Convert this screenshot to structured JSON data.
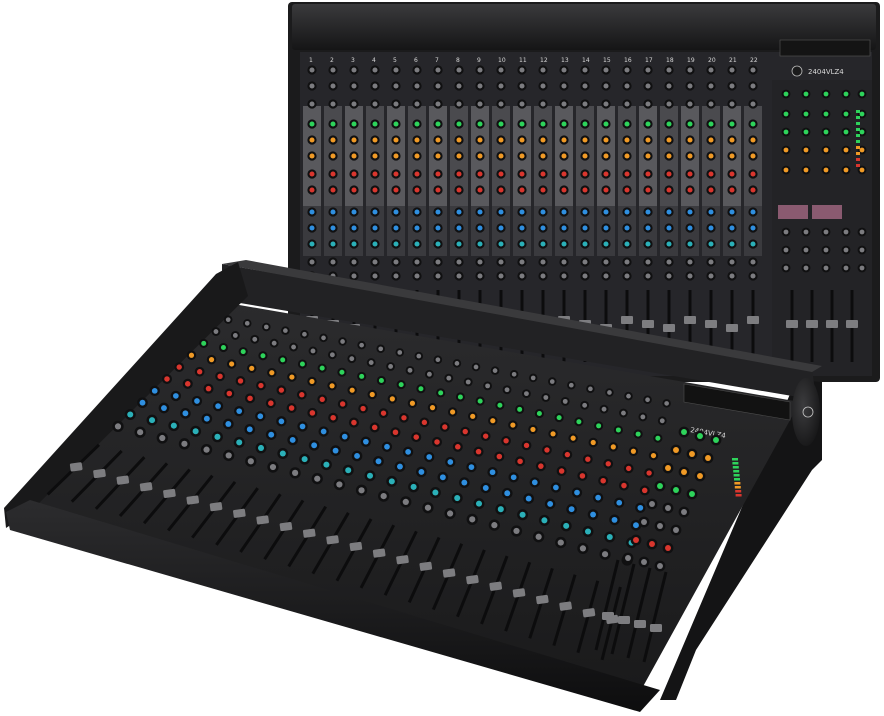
{
  "image": {
    "background": "#ffffff",
    "subject": "two audio mixing consoles",
    "colors": {
      "chassis": "#1b1b1c",
      "chassis_edge": "#2c2c2e",
      "panel": "#2a2a2c",
      "panel_strip": "#59595d",
      "knob_dark": "#101011",
      "knob_cap": "#7c7c80",
      "knob_green": "#2ed35b",
      "knob_orange": "#f09a26",
      "knob_red": "#d9362e",
      "knob_blue": "#2f8fe0",
      "knob_teal": "#2bb0b8",
      "fader_track": "#0c0c0d",
      "fader_cap": "#7d7d80"
    }
  },
  "back_mixer": {
    "view": "top-down",
    "channel_count": 22,
    "model_badge": "2404VLZ4",
    "channel_labels": [
      "1",
      "2",
      "3",
      "4",
      "5",
      "6",
      "7",
      "8",
      "9",
      "10",
      "11",
      "12",
      "13",
      "14",
      "15",
      "16",
      "17",
      "18",
      "19",
      "20",
      "21",
      "22"
    ]
  },
  "front_mixer": {
    "view": "angled",
    "channel_count": 24,
    "model_badge": "2404VLZ4"
  }
}
